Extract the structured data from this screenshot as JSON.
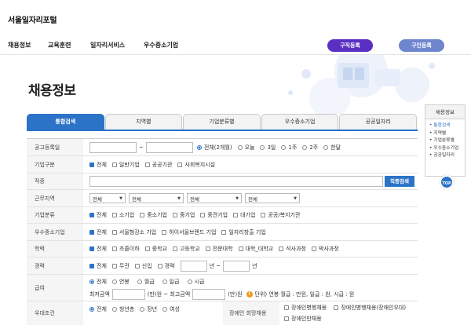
{
  "site": {
    "logo": "서울일자리포털"
  },
  "gnb": {
    "items": [
      "채용정보",
      "교육훈련",
      "일자리서비스",
      "우수중소기업"
    ],
    "job_register": "구직등록",
    "hire_register": "구인등록"
  },
  "page_title": "채용정보",
  "tabs": [
    "통합검색",
    "지역별",
    "기업분류별",
    "우수중소기업",
    "공공일자리"
  ],
  "form": {
    "date": {
      "label": "공고등록일",
      "tilde": "~",
      "options": [
        "전체(2개월)",
        "오늘",
        "3일",
        "1주",
        "2주",
        "한달"
      ]
    },
    "company_type": {
      "label": "기업구분",
      "options": [
        "전체",
        "일반기업",
        "공공기관",
        "사회복지시설"
      ]
    },
    "job": {
      "label": "직종",
      "search_btn": "직종검색"
    },
    "work_area": {
      "label": "근무지역",
      "selects": [
        "전체",
        "전체",
        "전체",
        "전체"
      ]
    },
    "company_class": {
      "label": "기업분류",
      "options": [
        "전체",
        "소기업",
        "중소기업",
        "중기업",
        "중견기업",
        "대기업",
        "공공/복지기관"
      ]
    },
    "sme": {
      "label": "우수중소기업",
      "options": [
        "전체",
        "서울형강소 기업",
        "하이서울브랜드 기업",
        "일자리창출 기업"
      ]
    },
    "education": {
      "label": "학력",
      "options": [
        "전체",
        "초졸이하",
        "중학교",
        "고등학교",
        "전문대학",
        "대학_대학교",
        "석사과정",
        "박사과정"
      ]
    },
    "career": {
      "label": "경력",
      "options": [
        "전체",
        "무관",
        "신입",
        "경력"
      ],
      "year1": "년 ~",
      "year2": "년"
    },
    "salary": {
      "label": "급여",
      "options": [
        "전체",
        "연봉",
        "월급",
        "일급",
        "시급"
      ],
      "min_label": "최저금액",
      "max_label": "(만)원  ~  최고금액",
      "unit": "(만)원",
      "note": "단위) 연봉·월급 : 만원, 일급 : 원, 시급 : 원"
    },
    "preference": {
      "label": "우대조건",
      "options": [
        "전체",
        "청년층",
        "장년",
        "여성"
      ],
      "disabled_label": "장애인 희망채용",
      "disabled_options": [
        "장애인병행채용",
        "장애인병행채용(장애인우대)",
        "장애인만채용"
      ]
    }
  },
  "sidebar": {
    "title": "채용정보",
    "items": [
      "• 통합검색",
      "• 지역별",
      "• 기업분류별",
      "• 우수중소기업",
      "• 공공일자리"
    ]
  },
  "top_button": "TOP"
}
